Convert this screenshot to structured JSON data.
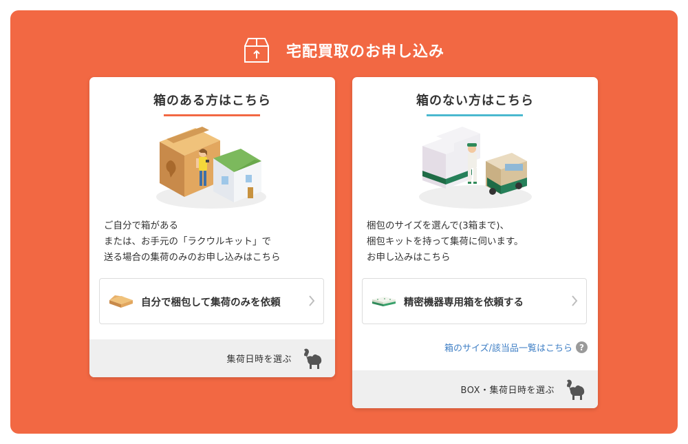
{
  "header": {
    "title": "宅配買取のお申し込み",
    "icon": "box-upload-icon"
  },
  "cards": [
    {
      "title": "箱のある方はこちら",
      "description": [
        "ご自分で箱がある",
        "または、お手元の「ラクウルキット」で",
        "送る場合の集荷のみのお申し込みはこちら"
      ],
      "button_label": "自分で梱包して集荷のみを依頼",
      "footer_label": "集荷日時を選ぶ"
    },
    {
      "title": "箱のない方はこちら",
      "description": [
        "梱包のサイズを選んで(3箱まで)、",
        "梱包キットを持って集荷に伺います。",
        "お申し込みはこちら"
      ],
      "button_label": "精密機器専用箱を依頼する",
      "size_link": "箱のサイズ/該当品一覧はこちら",
      "help_mark": "?",
      "footer_label": "BOX・集荷日時を選ぶ"
    }
  ],
  "colors": {
    "background": "#f26843",
    "accent_orange": "#f26843",
    "accent_blue": "#4ab8cf",
    "link": "#3f7fc5"
  }
}
